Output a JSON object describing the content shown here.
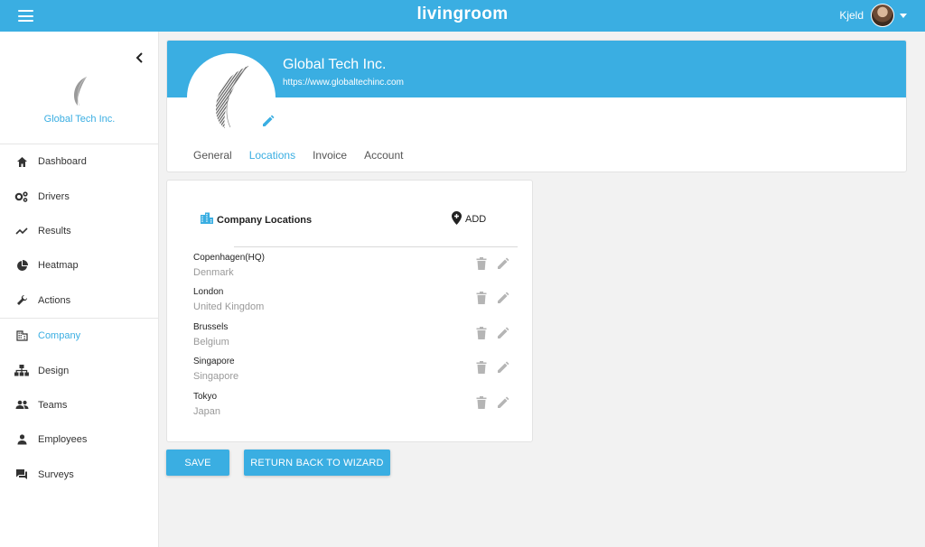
{
  "topbar": {
    "brand": "livingroom",
    "user_name": "Kjeld"
  },
  "sidebar": {
    "company_name": "Global Tech Inc.",
    "items": [
      {
        "label": "Dashboard",
        "icon": "home-icon"
      },
      {
        "label": "Drivers",
        "icon": "gears-icon"
      },
      {
        "label": "Results",
        "icon": "trending-icon"
      },
      {
        "label": "Heatmap",
        "icon": "pie-chart-icon"
      },
      {
        "label": "Actions",
        "icon": "wrench-icon"
      },
      {
        "label": "Company",
        "icon": "building-icon",
        "active": true
      },
      {
        "label": "Design",
        "icon": "hierarchy-icon"
      },
      {
        "label": "Teams",
        "icon": "people-icon"
      },
      {
        "label": "Employees",
        "icon": "person-icon"
      },
      {
        "label": "Surveys",
        "icon": "chat-icon"
      }
    ]
  },
  "company": {
    "name": "Global Tech Inc.",
    "url": "https://www.globaltechinc.com"
  },
  "tabs": [
    {
      "label": "General"
    },
    {
      "label": "Locations",
      "active": true
    },
    {
      "label": "Invoice"
    },
    {
      "label": "Account"
    }
  ],
  "locations": {
    "title": "Company Locations",
    "add_label": "ADD",
    "items": [
      {
        "city": "Copenhagen(HQ)",
        "country": "Denmark"
      },
      {
        "city": "London",
        "country": "United Kingdom"
      },
      {
        "city": "Brussels",
        "country": "Belgium"
      },
      {
        "city": "Singapore",
        "country": "Singapore"
      },
      {
        "city": "Tokyo",
        "country": "Japan"
      }
    ]
  },
  "buttons": {
    "save": "SAVE",
    "return": "RETURN BACK TO WIZARD"
  },
  "colors": {
    "accent": "#3aaee2",
    "icon_gray": "#b5b5b5"
  }
}
